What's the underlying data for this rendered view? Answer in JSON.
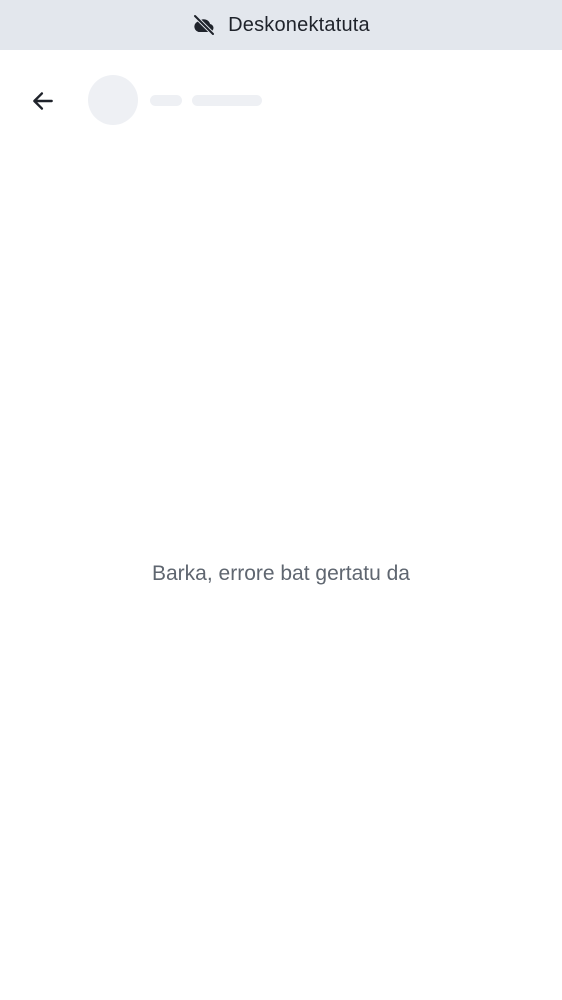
{
  "banner": {
    "icon": "cloud-off-icon",
    "text": "Deskonektatuta"
  },
  "header": {
    "back_icon": "arrow-left-icon"
  },
  "main": {
    "error_message": "Barka, errore bat gertatu da"
  },
  "colors": {
    "banner_bg": "#e3e7ed",
    "skeleton": "#eef0f4",
    "error_text": "#5f6670"
  }
}
